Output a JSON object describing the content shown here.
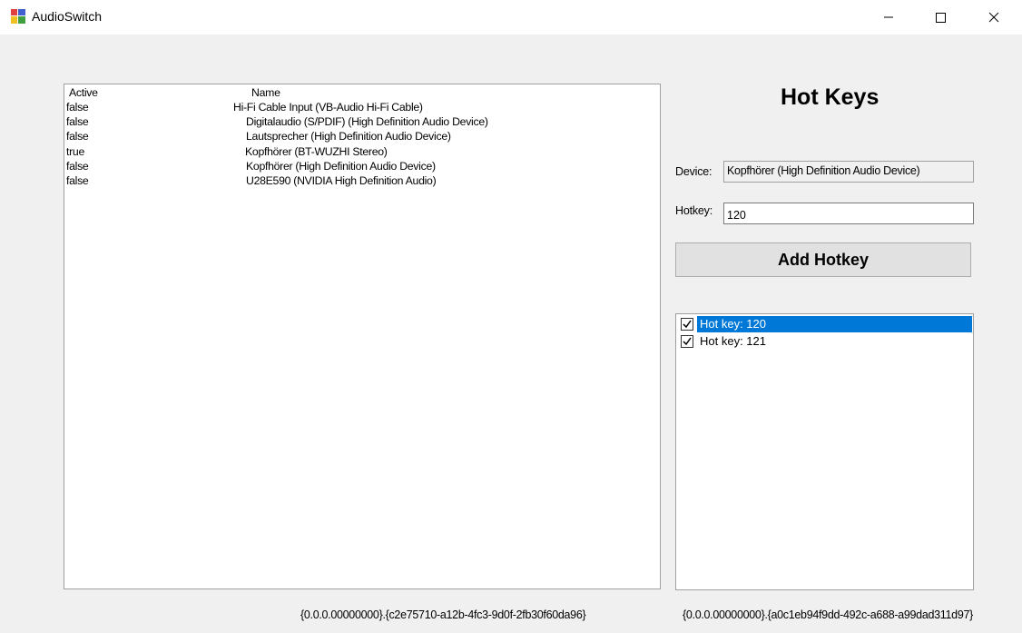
{
  "window": {
    "title": "AudioSwitch",
    "icon": "app-icon"
  },
  "device_list": {
    "columns": [
      "Active",
      "Name"
    ],
    "rows": [
      {
        "active": "false",
        "name": "Hi-Fi Cable Input (VB-Audio Hi-Fi Cable)"
      },
      {
        "active": "false",
        "name": "Digitalaudio (S/PDIF) (High Definition Audio Device)"
      },
      {
        "active": "false",
        "name": "Lautsprecher (High Definition Audio Device)"
      },
      {
        "active": "true",
        "name": "Kopfhörer (BT-WUZHI Stereo)"
      },
      {
        "active": "false",
        "name": "Kopfhörer (High Definition Audio Device)"
      },
      {
        "active": "false",
        "name": "U28E590 (NVIDIA High Definition Audio)"
      }
    ]
  },
  "hotkeys": {
    "heading": "Hot Keys",
    "device_label": "Device:",
    "device_value": "Kopfhörer (High Definition Audio Device)",
    "hotkey_label": "Hotkey:",
    "hotkey_value": "120",
    "add_button": "Add Hotkey",
    "items": [
      {
        "label": "Hot key: 120",
        "checked": true,
        "selected": true
      },
      {
        "label": "Hot key: 121",
        "checked": true,
        "selected": false
      }
    ]
  },
  "status": {
    "left": "{0.0.0.00000000}.{c2e75710-a12b-4fc3-9d0f-2fb30f60da96}",
    "right": "{0.0.0.00000000}.{a0c1eb94f9dd-492c-a688-a99dad311d97}"
  },
  "colors": {
    "selection": "#0078d7",
    "window_bg": "#f0f0f0"
  }
}
